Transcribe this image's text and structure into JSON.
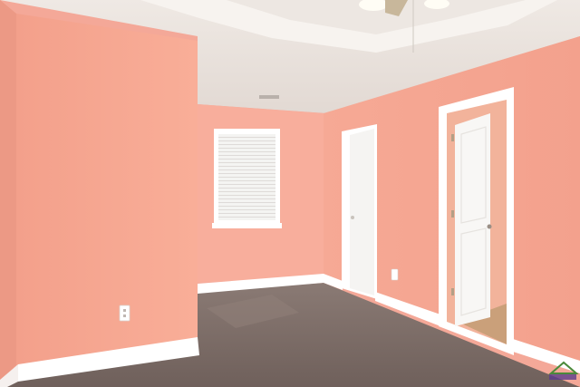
{
  "scene": {
    "description_visible_text": "",
    "colors": {
      "wall_left": "#f6a793",
      "wall_back": "#f8b0a0",
      "wall_right": "#f7ab99",
      "ceiling": "#e9e2dc",
      "ceiling_tray": "#f3eeea",
      "carpet": "#7c6c66",
      "trim": "#ffffff",
      "door": "#f7f7f5"
    },
    "icons": [
      "ceiling-fan-icon",
      "outlet-icon",
      "watermark-logo-icon"
    ]
  }
}
